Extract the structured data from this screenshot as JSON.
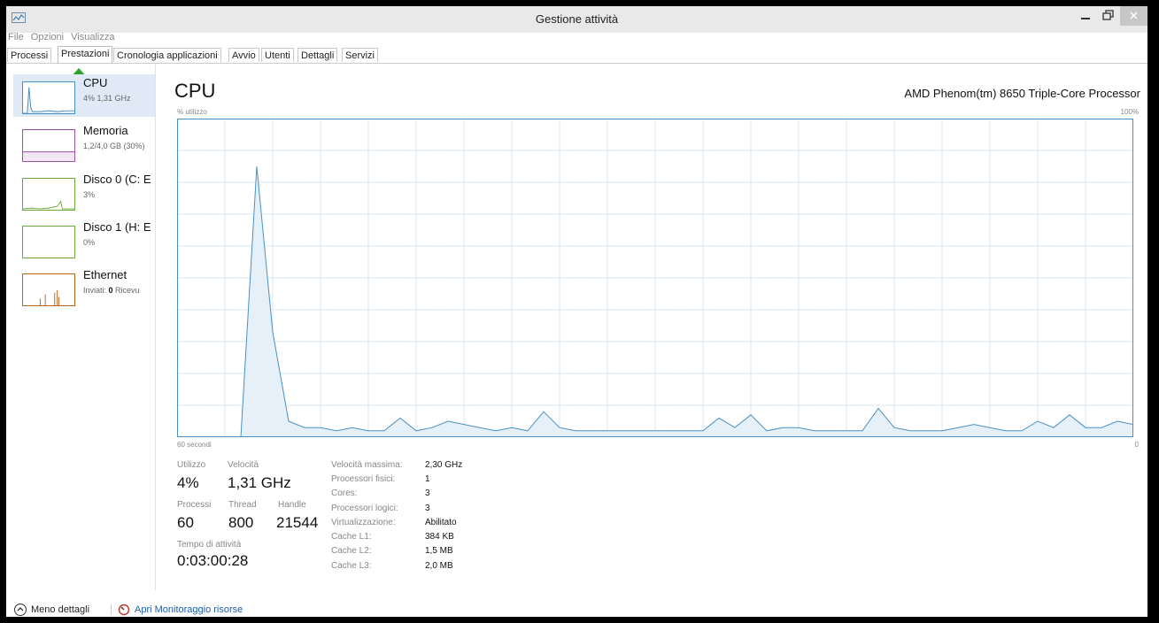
{
  "window": {
    "title": "Gestione attività"
  },
  "menu": [
    "File",
    "Opzioni",
    "Visualizza"
  ],
  "tabs": [
    "Processi",
    "Prestazioni",
    "Cronologia applicazioni",
    "Avvio",
    "Utenti",
    "Dettagli",
    "Servizi"
  ],
  "active_tab": "Prestazioni",
  "sidebar": [
    {
      "title": "CPU",
      "sub": "4% 1,31 GHz",
      "color": "#4a8fc4",
      "selected": true
    },
    {
      "title": "Memoria",
      "sub": "1,2/4,0 GB (30%)",
      "color": "#9b4fa8"
    },
    {
      "title": "Disco 0 (C: E",
      "sub": "3%",
      "color": "#6ea83c"
    },
    {
      "title": "Disco 1 (H: E",
      "sub": "0%",
      "color": "#6ea83c"
    },
    {
      "title": "Ethernet",
      "sub_prefix": "Inviati: ",
      "sub_bold": "0",
      "sub_suffix": " Ricevu",
      "color": "#b5651d"
    }
  ],
  "main": {
    "title": "CPU",
    "processor": "AMD Phenom(tm) 8650 Triple-Core Processor",
    "y_label": "% utilizzo",
    "y_max": "100%",
    "x_left": "60 secondi",
    "x_right": "0"
  },
  "chart_data": {
    "type": "area",
    "ylim": [
      0,
      100
    ],
    "xlim": [
      60,
      0
    ],
    "color": "#4a8fc4",
    "fill": "#e6f0f8",
    "values": [
      0,
      0,
      0,
      0,
      0,
      85,
      33,
      5,
      3,
      3,
      2,
      3,
      2,
      2,
      6,
      2,
      3,
      5,
      4,
      3,
      2,
      3,
      2,
      8,
      3,
      2,
      2,
      2,
      2,
      2,
      2,
      2,
      2,
      2,
      6,
      3,
      7,
      2,
      3,
      3,
      2,
      2,
      2,
      2,
      9,
      3,
      2,
      2,
      2,
      3,
      4,
      3,
      2,
      2,
      5,
      3,
      7,
      3,
      3,
      5,
      4
    ]
  },
  "stats": {
    "utilizzo_label": "Utilizzo",
    "utilizzo": "4%",
    "velocita_label": "Velocità",
    "velocita": "1,31 GHz",
    "processi_label": "Processi",
    "processi": "60",
    "thread_label": "Thread",
    "thread": "800",
    "handle_label": "Handle",
    "handle": "21544",
    "uptime_label": "Tempo di attività",
    "uptime": "0:03:00:28"
  },
  "info": [
    {
      "label": "Velocità massima:",
      "value": "2,30 GHz"
    },
    {
      "label": "Processori fisici:",
      "value": "1"
    },
    {
      "label": "Cores:",
      "value": "3"
    },
    {
      "label": "Processori logici:",
      "value": "3"
    },
    {
      "label": "Virtualizzazione:",
      "value": "Abilitato"
    },
    {
      "label": "Cache L1:",
      "value": "384 KB"
    },
    {
      "label": "Cache L2:",
      "value": "1,5 MB"
    },
    {
      "label": "Cache L3:",
      "value": "2,0 MB"
    }
  ],
  "footer": {
    "less_details": "Meno dettagli",
    "open_monitor": "Apri Monitoraggio risorse"
  }
}
